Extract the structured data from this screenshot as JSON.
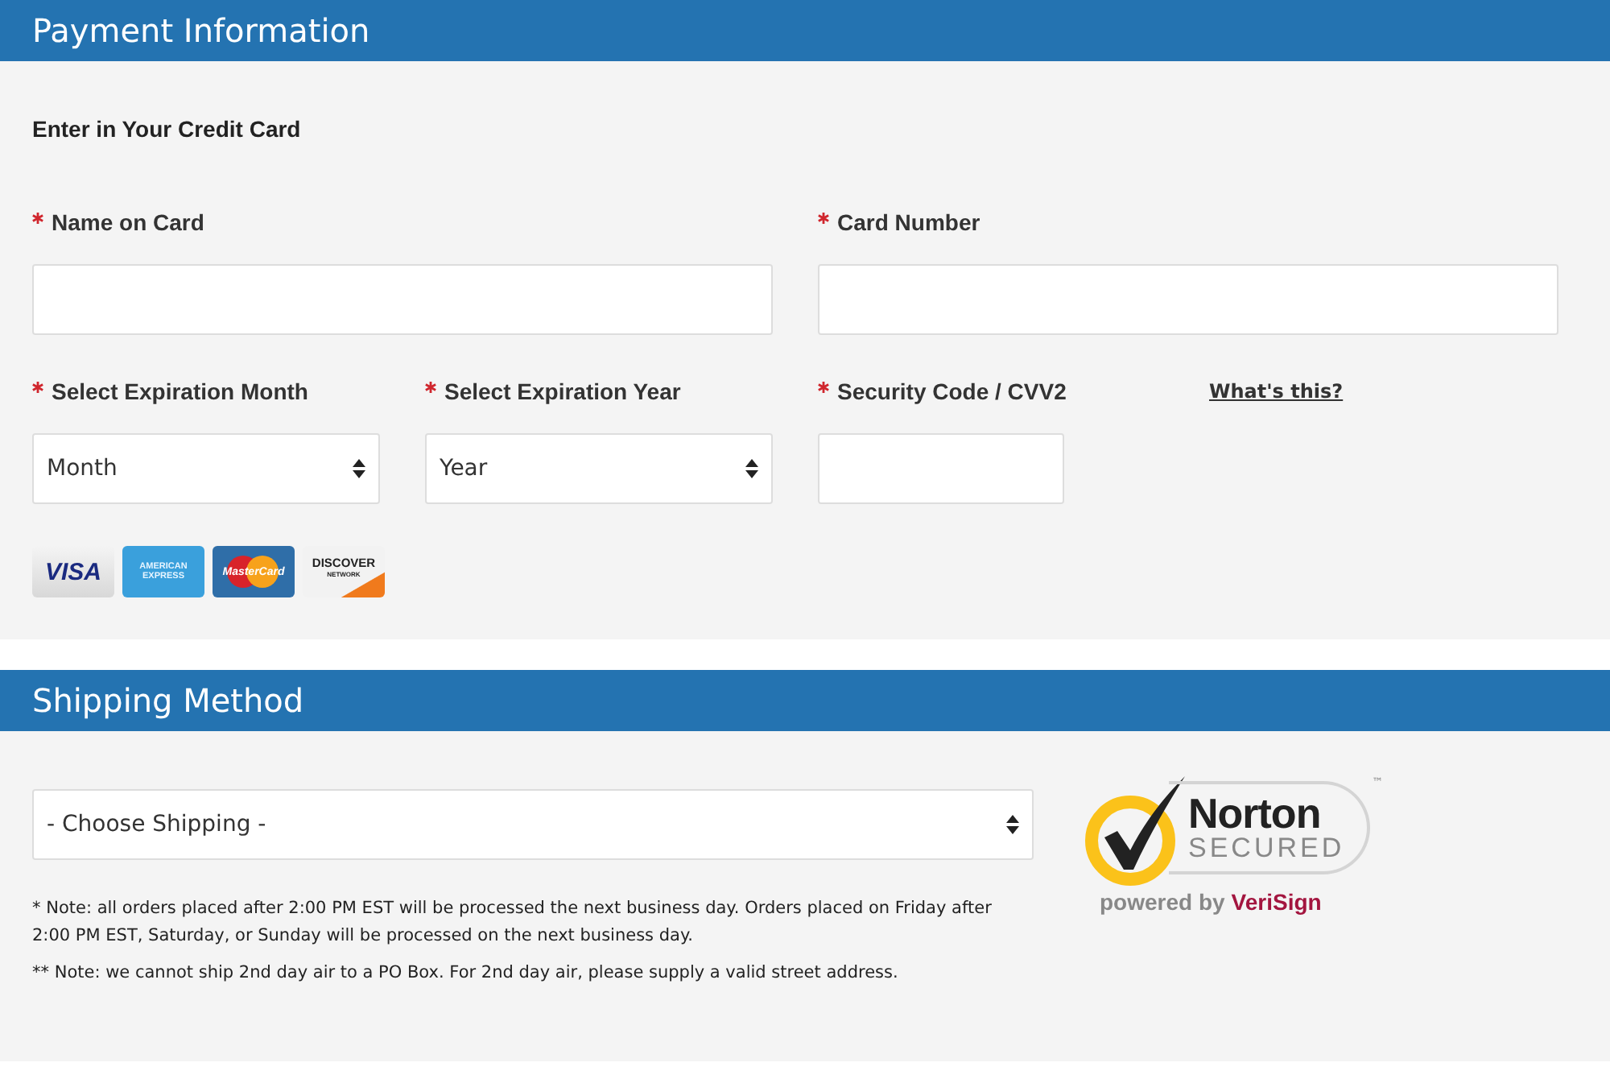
{
  "payment": {
    "title": "Payment Information",
    "subtitle": "Enter in Your Credit Card",
    "fields": [
      {
        "kind": "text",
        "label": "Name on Card",
        "required": true
      },
      {
        "kind": "text",
        "label": "Card Number",
        "required": true
      },
      {
        "kind": "select",
        "label": "Select Expiration Month",
        "required": true,
        "value": "Month"
      },
      {
        "kind": "select",
        "label": "Select Expiration Year",
        "required": true,
        "value": "Year"
      },
      {
        "kind": "short",
        "label": "Security Code / CVV2",
        "required": true,
        "link": "What's this?"
      }
    ],
    "card_logos": [
      {
        "kind": "visa",
        "text": "VISA"
      },
      {
        "kind": "amex",
        "text": "AMERICAN EXPRESS"
      },
      {
        "kind": "mastercard",
        "text": "MasterCard"
      },
      {
        "kind": "discover",
        "text": "DISCOVER",
        "subtext": "NETWORK"
      }
    ]
  },
  "shipping": {
    "title": "Shipping Method",
    "select": {
      "value": "- Choose Shipping -"
    },
    "notes": [
      "* Note: all orders placed after 2:00 PM EST will be processed the next business day. Orders placed on Friday after 2:00 PM EST, Saturday, or Sunday will be processed on the next business day.",
      "** Note: we cannot ship 2nd day air to a PO Box. For 2nd day air, please supply a valid street address."
    ],
    "seal": {
      "brand": "Norton",
      "status": "SECURED",
      "trademark": "™",
      "powered_by": "powered by",
      "provider": "VeriSign"
    }
  }
}
